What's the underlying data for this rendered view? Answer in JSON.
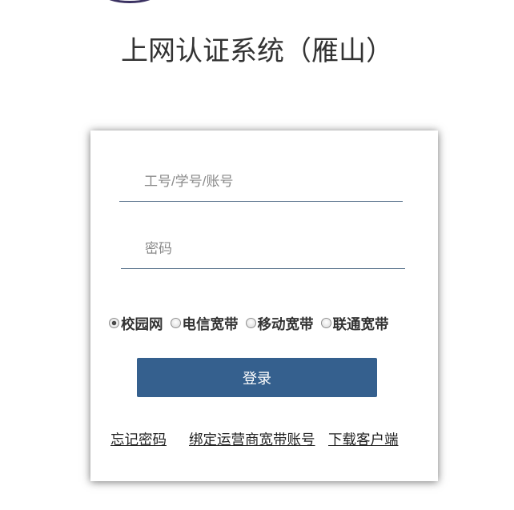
{
  "header": {
    "title": "上网认证系统（雁山）",
    "logo_icon": "university-logo-icon"
  },
  "form": {
    "username_placeholder": "工号/学号/账号",
    "password_placeholder": "密码",
    "network_options": [
      {
        "label": "校园网",
        "checked": true
      },
      {
        "label": "电信宽带",
        "checked": false
      },
      {
        "label": "移动宽带",
        "checked": false
      },
      {
        "label": "联通宽带",
        "checked": false
      }
    ],
    "login_label": "登录"
  },
  "links": {
    "forgot_password": "忘记密码",
    "bind_isp": "绑定运营商宽带账号",
    "download_client": "下载客户端"
  },
  "colors": {
    "primary": "#35608e",
    "text": "#333333",
    "input_line": "#56708a",
    "link": "#222222"
  }
}
